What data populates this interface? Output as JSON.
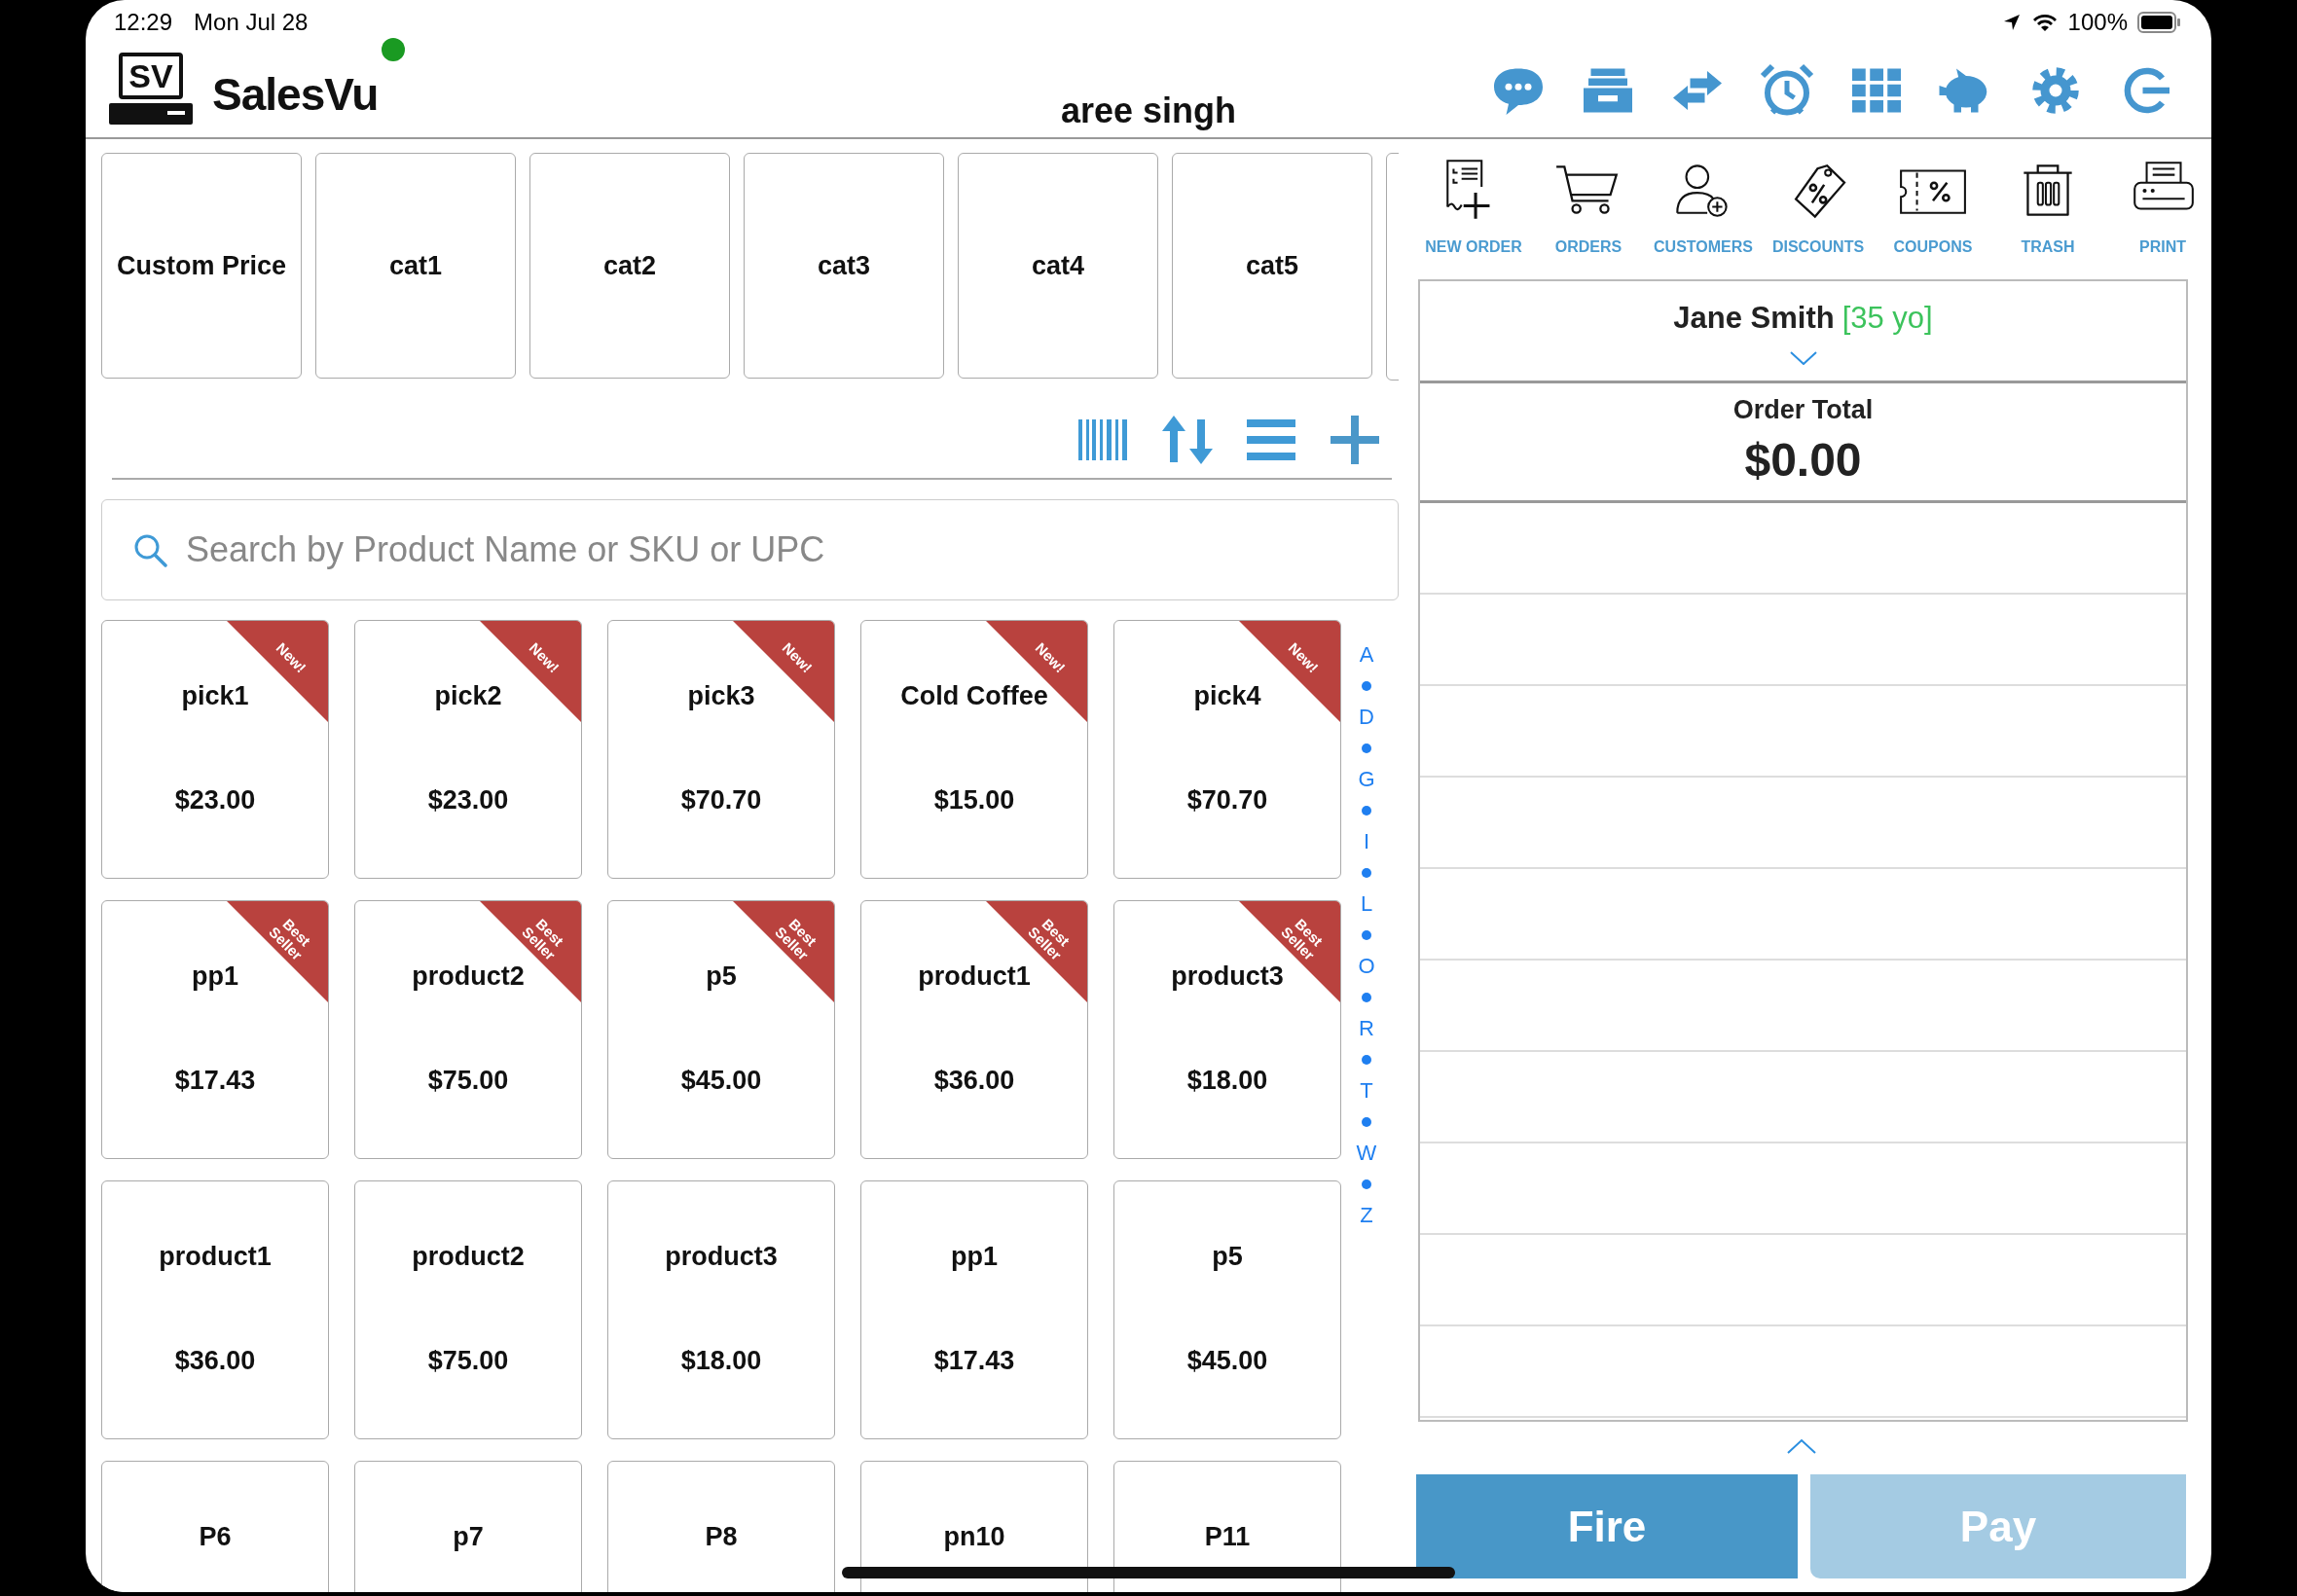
{
  "status_bar": {
    "time": "12:29",
    "date": "Mon Jul 28",
    "battery": "100%"
  },
  "header": {
    "logo_text": "SV",
    "brand": "SalesVu",
    "online": true,
    "user": "aree singh"
  },
  "categories": [
    {
      "label": "Custom Price"
    },
    {
      "label": "cat1"
    },
    {
      "label": "cat2"
    },
    {
      "label": "cat3"
    },
    {
      "label": "cat4"
    },
    {
      "label": "cat5"
    }
  ],
  "category_overflow": true,
  "search": {
    "placeholder": "Search by Product Name or SKU or UPC"
  },
  "products": [
    {
      "name": "pick1",
      "price": "$23.00",
      "badge": "New!"
    },
    {
      "name": "pick2",
      "price": "$23.00",
      "badge": "New!"
    },
    {
      "name": "pick3",
      "price": "$70.70",
      "badge": "New!"
    },
    {
      "name": "Cold Coffee",
      "price": "$15.00",
      "badge": "New!"
    },
    {
      "name": "pick4",
      "price": "$70.70",
      "badge": "New!"
    },
    {
      "name": "pp1",
      "price": "$17.43",
      "badge": "Best Seller"
    },
    {
      "name": "product2",
      "price": "$75.00",
      "badge": "Best Seller"
    },
    {
      "name": "p5",
      "price": "$45.00",
      "badge": "Best Seller"
    },
    {
      "name": "product1",
      "price": "$36.00",
      "badge": "Best Seller"
    },
    {
      "name": "product3",
      "price": "$18.00",
      "badge": "Best Seller"
    },
    {
      "name": "product1",
      "price": "$36.00"
    },
    {
      "name": "product2",
      "price": "$75.00"
    },
    {
      "name": "product3",
      "price": "$18.00"
    },
    {
      "name": "pp1",
      "price": "$17.43"
    },
    {
      "name": "p5",
      "price": "$45.00"
    },
    {
      "name": "P6"
    },
    {
      "name": "p7"
    },
    {
      "name": "P8"
    },
    {
      "name": "pn10"
    },
    {
      "name": "P11"
    }
  ],
  "index_letters": [
    "A",
    "D",
    "G",
    "I",
    "L",
    "O",
    "R",
    "T",
    "W",
    "Z"
  ],
  "actions": [
    {
      "label": "NEW ORDER"
    },
    {
      "label": "ORDERS"
    },
    {
      "label": "CUSTOMERS"
    },
    {
      "label": "DISCOUNTS"
    },
    {
      "label": "COUPONS"
    },
    {
      "label": "TRASH"
    },
    {
      "label": "PRINT"
    }
  ],
  "customer": {
    "name": "Jane Smith",
    "age": "[35 yo]"
  },
  "order_total": {
    "label": "Order Total",
    "amount": "$0.00"
  },
  "buttons": [
    {
      "label": "Fire",
      "disabled": false
    },
    {
      "label": "Pay",
      "disabled": true
    }
  ]
}
